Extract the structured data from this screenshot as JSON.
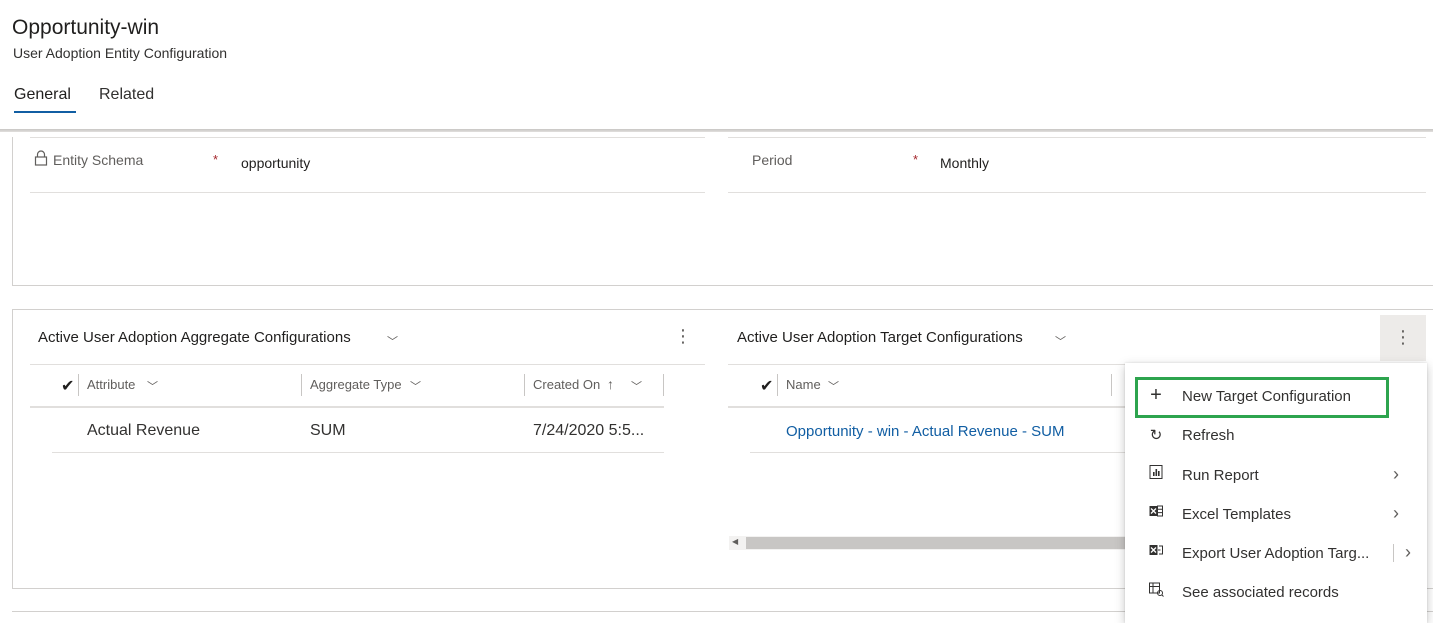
{
  "header": {
    "title": "Opportunity-win",
    "subtitle": "User Adoption Entity Configuration",
    "tabs": [
      {
        "label": "General",
        "selected": true
      },
      {
        "label": "Related",
        "selected": false
      }
    ]
  },
  "form": {
    "entity_schema": {
      "label": "Entity Schema",
      "value": "opportunity",
      "required_mark": "*",
      "locked": true
    },
    "period": {
      "label": "Period",
      "value": "Monthly",
      "required_mark": "*"
    }
  },
  "aggregate_grid": {
    "title": "Active User Adoption Aggregate Configurations",
    "columns": [
      {
        "label": "Attribute",
        "sort": ""
      },
      {
        "label": "Aggregate Type",
        "sort": ""
      },
      {
        "label": "Created On",
        "sort": "↑"
      }
    ],
    "rows": [
      {
        "attribute": "Actual Revenue",
        "aggregate_type": "SUM",
        "created_on": "7/24/2020 5:5..."
      }
    ]
  },
  "target_grid": {
    "title": "Active User Adoption Target Configurations",
    "columns": [
      {
        "label": "Name"
      }
    ],
    "rows": [
      {
        "name": "Opportunity - win - Actual Revenue - SUM"
      }
    ]
  },
  "context_menu": {
    "items": [
      {
        "label": "New Target Configuration",
        "icon": "plus-icon",
        "submenu": false,
        "highlighted": true
      },
      {
        "label": "Refresh",
        "icon": "refresh-icon",
        "submenu": false
      },
      {
        "label": "Run Report",
        "icon": "report-icon",
        "submenu": true
      },
      {
        "label": "Excel Templates",
        "icon": "excel-template-icon",
        "submenu": true
      },
      {
        "label": "Export User Adoption Targ...",
        "icon": "excel-export-icon",
        "submenu": true
      },
      {
        "label": "See associated records",
        "icon": "associated-records-icon",
        "submenu": false
      }
    ],
    "highlight_color": "#2da44e"
  },
  "colors": {
    "accent": "#115ea3",
    "required": "#a4262c",
    "link": "#115ea3"
  }
}
